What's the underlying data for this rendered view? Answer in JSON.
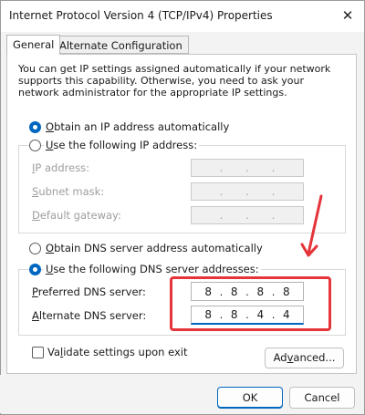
{
  "window": {
    "title": "Internet Protocol Version 4 (TCP/IPv4) Properties",
    "close_glyph": "✕"
  },
  "tabs": [
    {
      "label": "General",
      "active": true
    },
    {
      "label": "Alternate Configuration",
      "active": false
    }
  ],
  "intro": "You can get IP settings assigned automatically if your network supports this capability. Otherwise, you need to ask your network administrator for the appropriate IP settings.",
  "ip": {
    "auto_prefix": "",
    "auto_accel": "O",
    "auto_rest": "btain an IP address automatically",
    "manual_accel": "U",
    "manual_rest": "se the following IP address:",
    "fields": [
      {
        "accel": "I",
        "rest": "P address:",
        "value": [
          "",
          "",
          "",
          ""
        ]
      },
      {
        "accel": "S",
        "rest": "ubnet mask:",
        "value": [
          "",
          "",
          "",
          ""
        ],
        "accel_index": 1
      },
      {
        "accel": "D",
        "rest": "efault gateway:",
        "value": [
          "",
          "",
          "",
          ""
        ]
      }
    ]
  },
  "dns": {
    "auto_accel": "O",
    "auto_rest": "btain DNS server address automatically",
    "manual_accel": "U",
    "manual_rest": "se the following DNS server addresses:",
    "preferred_accel": "P",
    "preferred_rest": "referred DNS server:",
    "alternate_accel": "A",
    "alternate_rest": "lternate DNS server:",
    "preferred": [
      "8",
      "8",
      "8",
      "8"
    ],
    "alternate": [
      "8",
      "8",
      "4",
      "4"
    ]
  },
  "validate": {
    "pre": "Va",
    "accel": "l",
    "rest": "idate settings upon exit"
  },
  "buttons": {
    "advanced_pre": "Ad",
    "advanced_accel": "v",
    "advanced_rest": "anced...",
    "ok": "OK",
    "cancel": "Cancel"
  },
  "colors": {
    "accent": "#0067c0",
    "annotation": "#e5343a"
  }
}
